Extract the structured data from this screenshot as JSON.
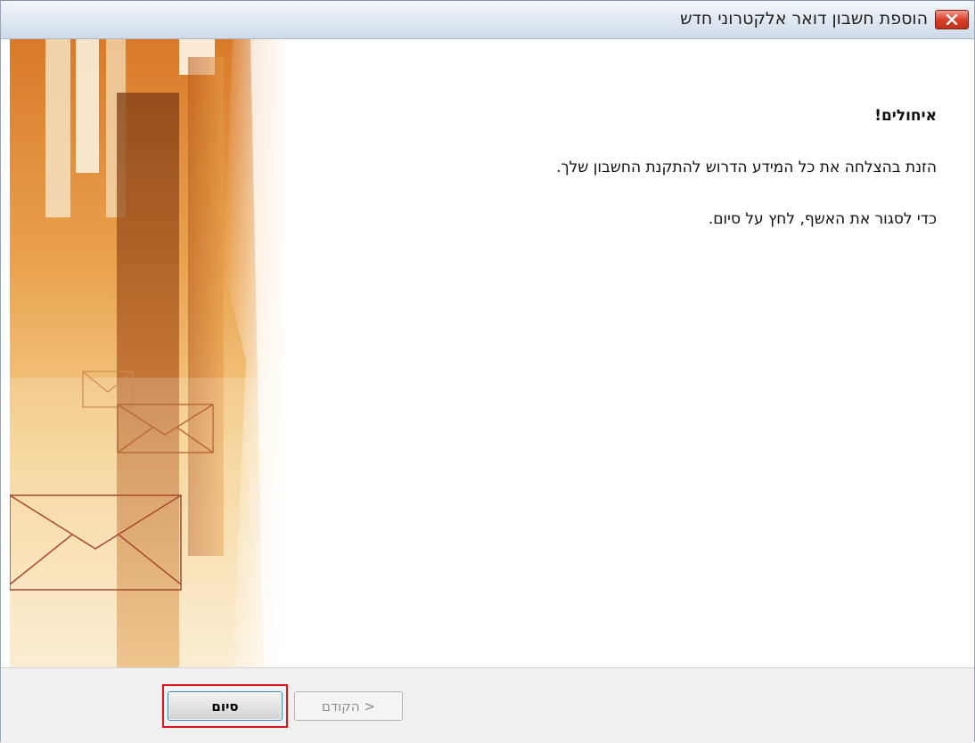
{
  "window": {
    "title": "הוספת חשבון דואר אלקטרוני חדש"
  },
  "main": {
    "headline": "איחולים!",
    "line1": "הזנת בהצלחה את כל המידע הדרוש להתקנת החשבון שלך.",
    "line2": "כדי לסגור את האשף, לחץ על סיום."
  },
  "footer": {
    "finish_label": "סיום",
    "back_label": "< הקודם"
  },
  "colors": {
    "highlight": "#e0141e",
    "close_button": "#d8402b",
    "art_orange": "#d9822b"
  },
  "icons": [
    "close-icon",
    "envelope-icon"
  ]
}
